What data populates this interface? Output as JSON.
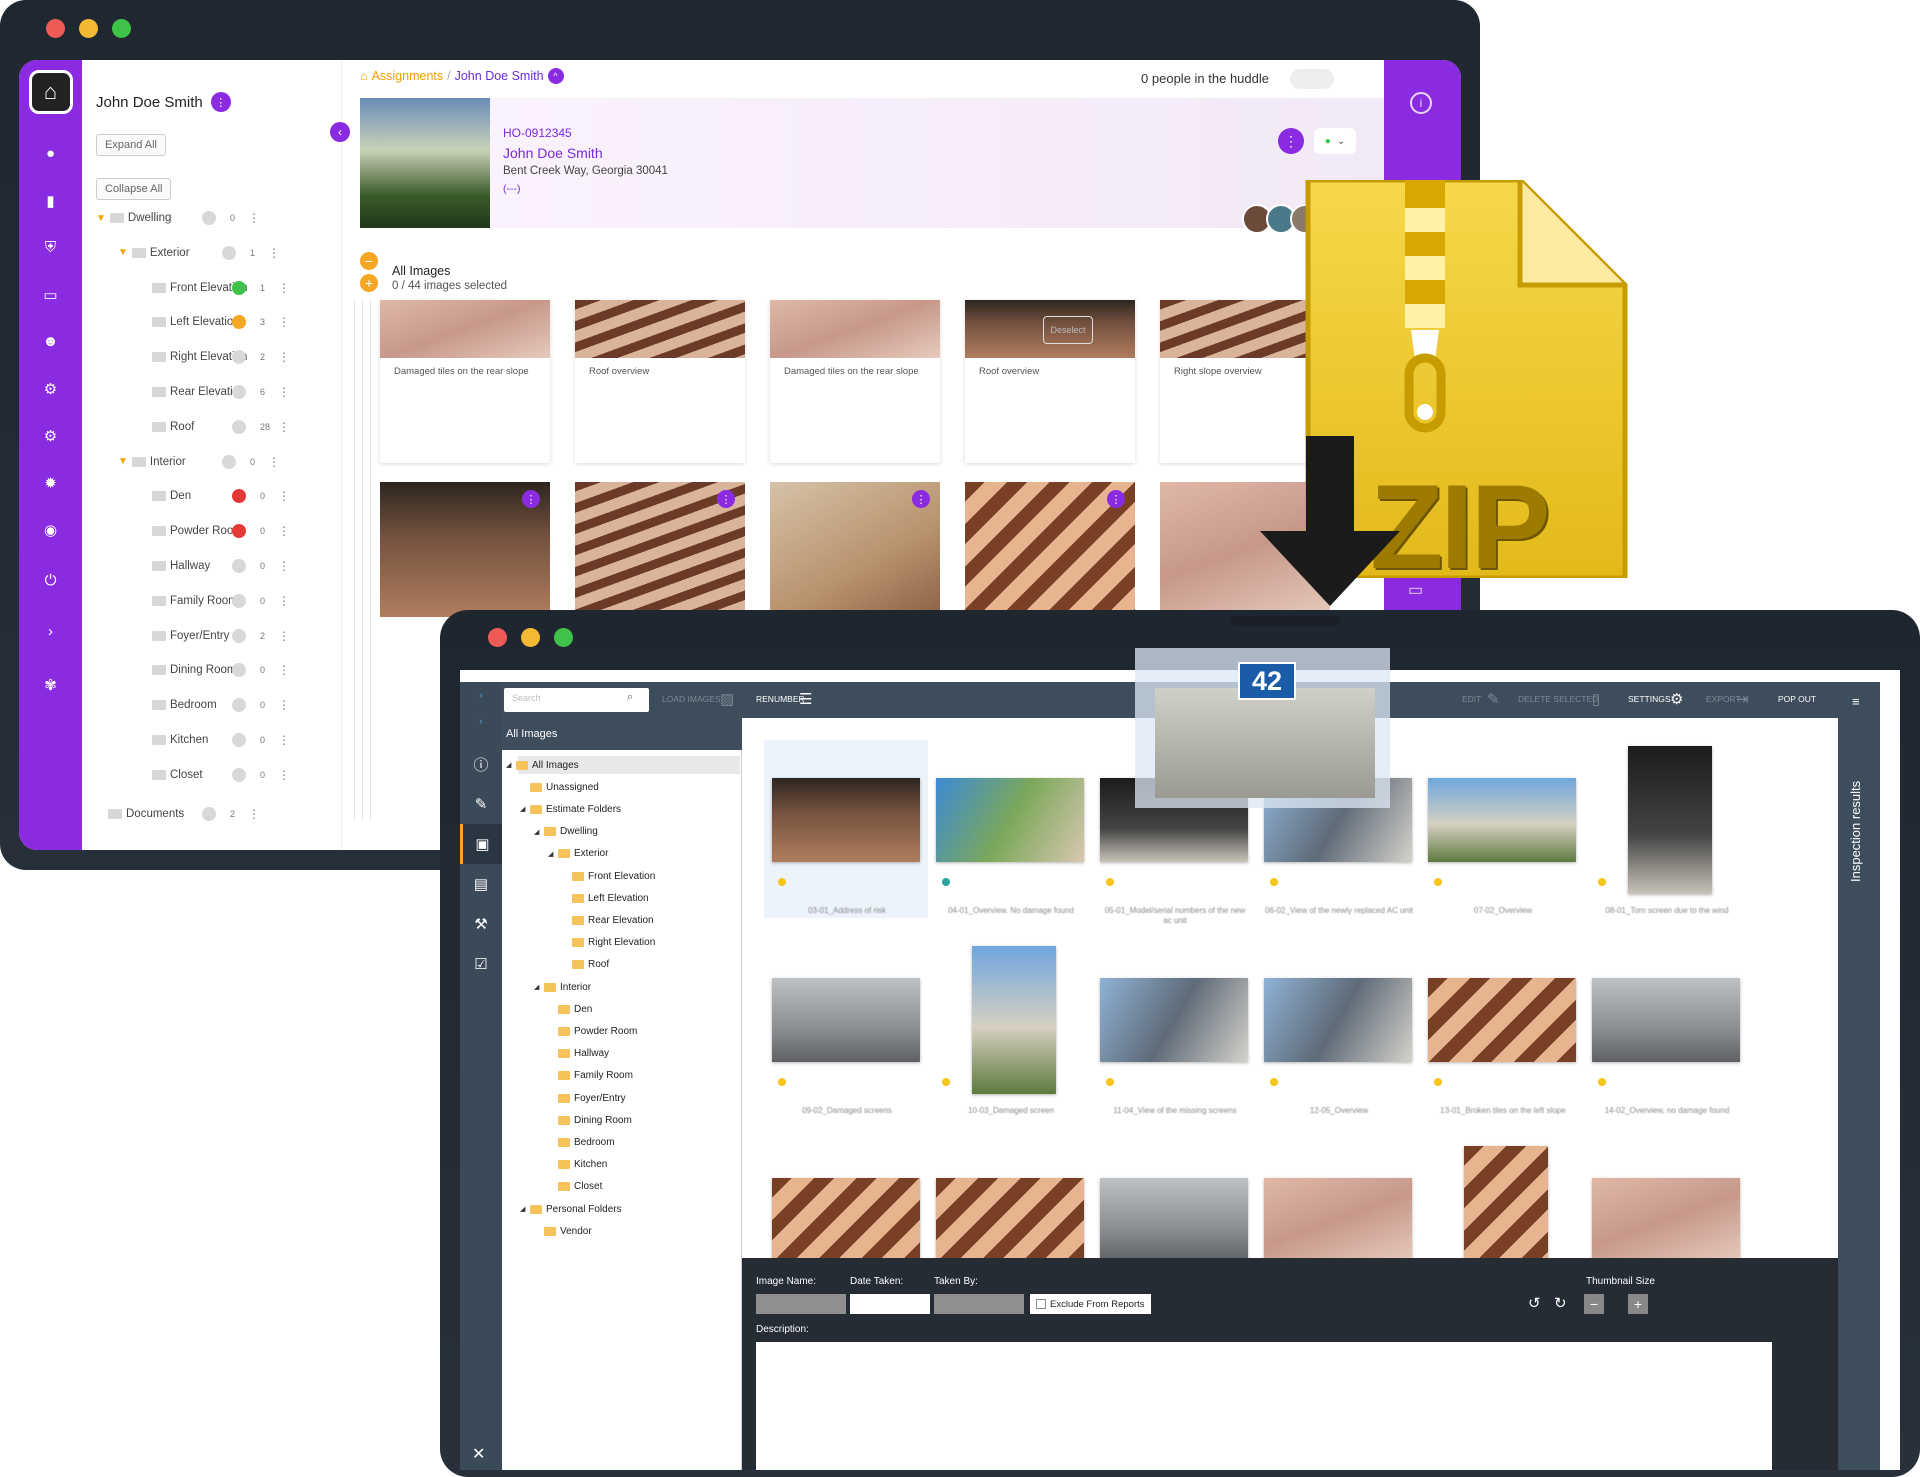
{
  "back_window": {
    "user_name": "John Doe Smith",
    "expand_all": "Expand All",
    "collapse_all": "Collapse All",
    "tree": [
      {
        "label": "Dwelling",
        "count": "0",
        "status": "gray"
      },
      {
        "label": "Exterior",
        "count": "1",
        "status": "gray"
      },
      {
        "label": "Front Elevation",
        "count": "1",
        "status": "green"
      },
      {
        "label": "Left Elevation",
        "count": "3",
        "status": "orange"
      },
      {
        "label": "Right Elevation",
        "count": "2",
        "status": "gray"
      },
      {
        "label": "Rear Elevation",
        "count": "6",
        "status": "gray"
      },
      {
        "label": "Roof",
        "count": "28",
        "status": "gray"
      },
      {
        "label": "Interior",
        "count": "0",
        "status": "gray"
      },
      {
        "label": "Den",
        "count": "0",
        "status": "red"
      },
      {
        "label": "Powder Room",
        "count": "0",
        "status": "red"
      },
      {
        "label": "Hallway",
        "count": "0",
        "status": "gray"
      },
      {
        "label": "Family Room",
        "count": "0",
        "status": "gray"
      },
      {
        "label": "Foyer/Entry",
        "count": "2",
        "status": "gray"
      },
      {
        "label": "Dining Room",
        "count": "0",
        "status": "gray"
      },
      {
        "label": "Bedroom",
        "count": "0",
        "status": "gray"
      },
      {
        "label": "Kitchen",
        "count": "0",
        "status": "gray"
      },
      {
        "label": "Closet",
        "count": "0",
        "status": "gray"
      },
      {
        "label": "Documents",
        "count": "2",
        "status": "gray"
      }
    ],
    "breadcrumb": {
      "root": "Assignments",
      "separator": "/",
      "current": "John Doe Smith"
    },
    "huddle_text": "0 people in the huddle",
    "claim": {
      "id": "HO-0912345",
      "name": "John Doe Smith",
      "address": "Bent Creek Way, Georgia 30041",
      "phone": "(---)"
    },
    "all_images_title": "All Images",
    "images_selected": "0 / 44 images selected",
    "deselect_label": "Deselect",
    "card_captions": [
      "Damaged tiles on the rear slope",
      "Roof overview",
      "Damaged tiles on the rear slope",
      "Roof overview",
      "Right slope overview"
    ],
    "colors": {
      "accent": "#8a2be2",
      "brand_orange": "#f5a623"
    }
  },
  "zip_badge": {
    "label": "ZIP"
  },
  "front_window": {
    "search_placeholder": "Search",
    "toolbar": {
      "load_images": "LOAD IMAGES",
      "renumber": "RENUMBER",
      "edit": "EDIT",
      "delete_selected": "DELETE SELECTED",
      "settings": "SETTINGS",
      "export": "EXPORT",
      "pop_out": "POP OUT"
    },
    "tree_header": "All Images",
    "tree": [
      {
        "label": "All Images",
        "depth": 1,
        "expanded": true
      },
      {
        "label": "Unassigned",
        "depth": 2
      },
      {
        "label": "Estimate Folders",
        "depth": 2,
        "expanded": true
      },
      {
        "label": "Dwelling",
        "depth": 3,
        "expanded": true
      },
      {
        "label": "Exterior",
        "depth": 4,
        "expanded": true
      },
      {
        "label": "Front Elevation",
        "depth": 5
      },
      {
        "label": "Left Elevation",
        "depth": 5
      },
      {
        "label": "Rear Elevation",
        "depth": 5
      },
      {
        "label": "Right Elevation",
        "depth": 5
      },
      {
        "label": "Roof",
        "depth": 5
      },
      {
        "label": "Interior",
        "depth": 3,
        "expanded": true
      },
      {
        "label": "Den",
        "depth": 4
      },
      {
        "label": "Powder Room",
        "depth": 4
      },
      {
        "label": "Hallway",
        "depth": 4
      },
      {
        "label": "Family Room",
        "depth": 4
      },
      {
        "label": "Foyer/Entry",
        "depth": 4
      },
      {
        "label": "Dining Room",
        "depth": 4
      },
      {
        "label": "Bedroom",
        "depth": 4
      },
      {
        "label": "Kitchen",
        "depth": 4
      },
      {
        "label": "Closet",
        "depth": 4
      },
      {
        "label": "Personal Folders",
        "depth": 2,
        "expanded": true
      },
      {
        "label": "Vendor",
        "depth": 3
      }
    ],
    "thumb_captions": [
      "03-01_Address of risk",
      "04-01_Overview. No damage found",
      "05-01_Model/serial numbers of the new ac unit",
      "06-02_View of the newly replaced AC unit",
      "07-02_Overview",
      "08-01_Torn screen due to the wind",
      "09-02_Damaged screens",
      "10-03_Damaged screen",
      "11-04_View of the missing screens",
      "12-05_Overview",
      "13-01_Broken tiles on the left slope",
      "14-02_Overview, no damage found",
      "",
      "",
      "",
      "",
      "",
      ""
    ],
    "drag_count": "42",
    "detail": {
      "image_name": "Image Name:",
      "date_taken": "Date Taken:",
      "taken_by": "Taken By:",
      "exclude": "Exclude From Reports",
      "thumbnail_size": "Thumbnail Size",
      "description": "Description:"
    },
    "inspection_results": "Inspection results"
  }
}
